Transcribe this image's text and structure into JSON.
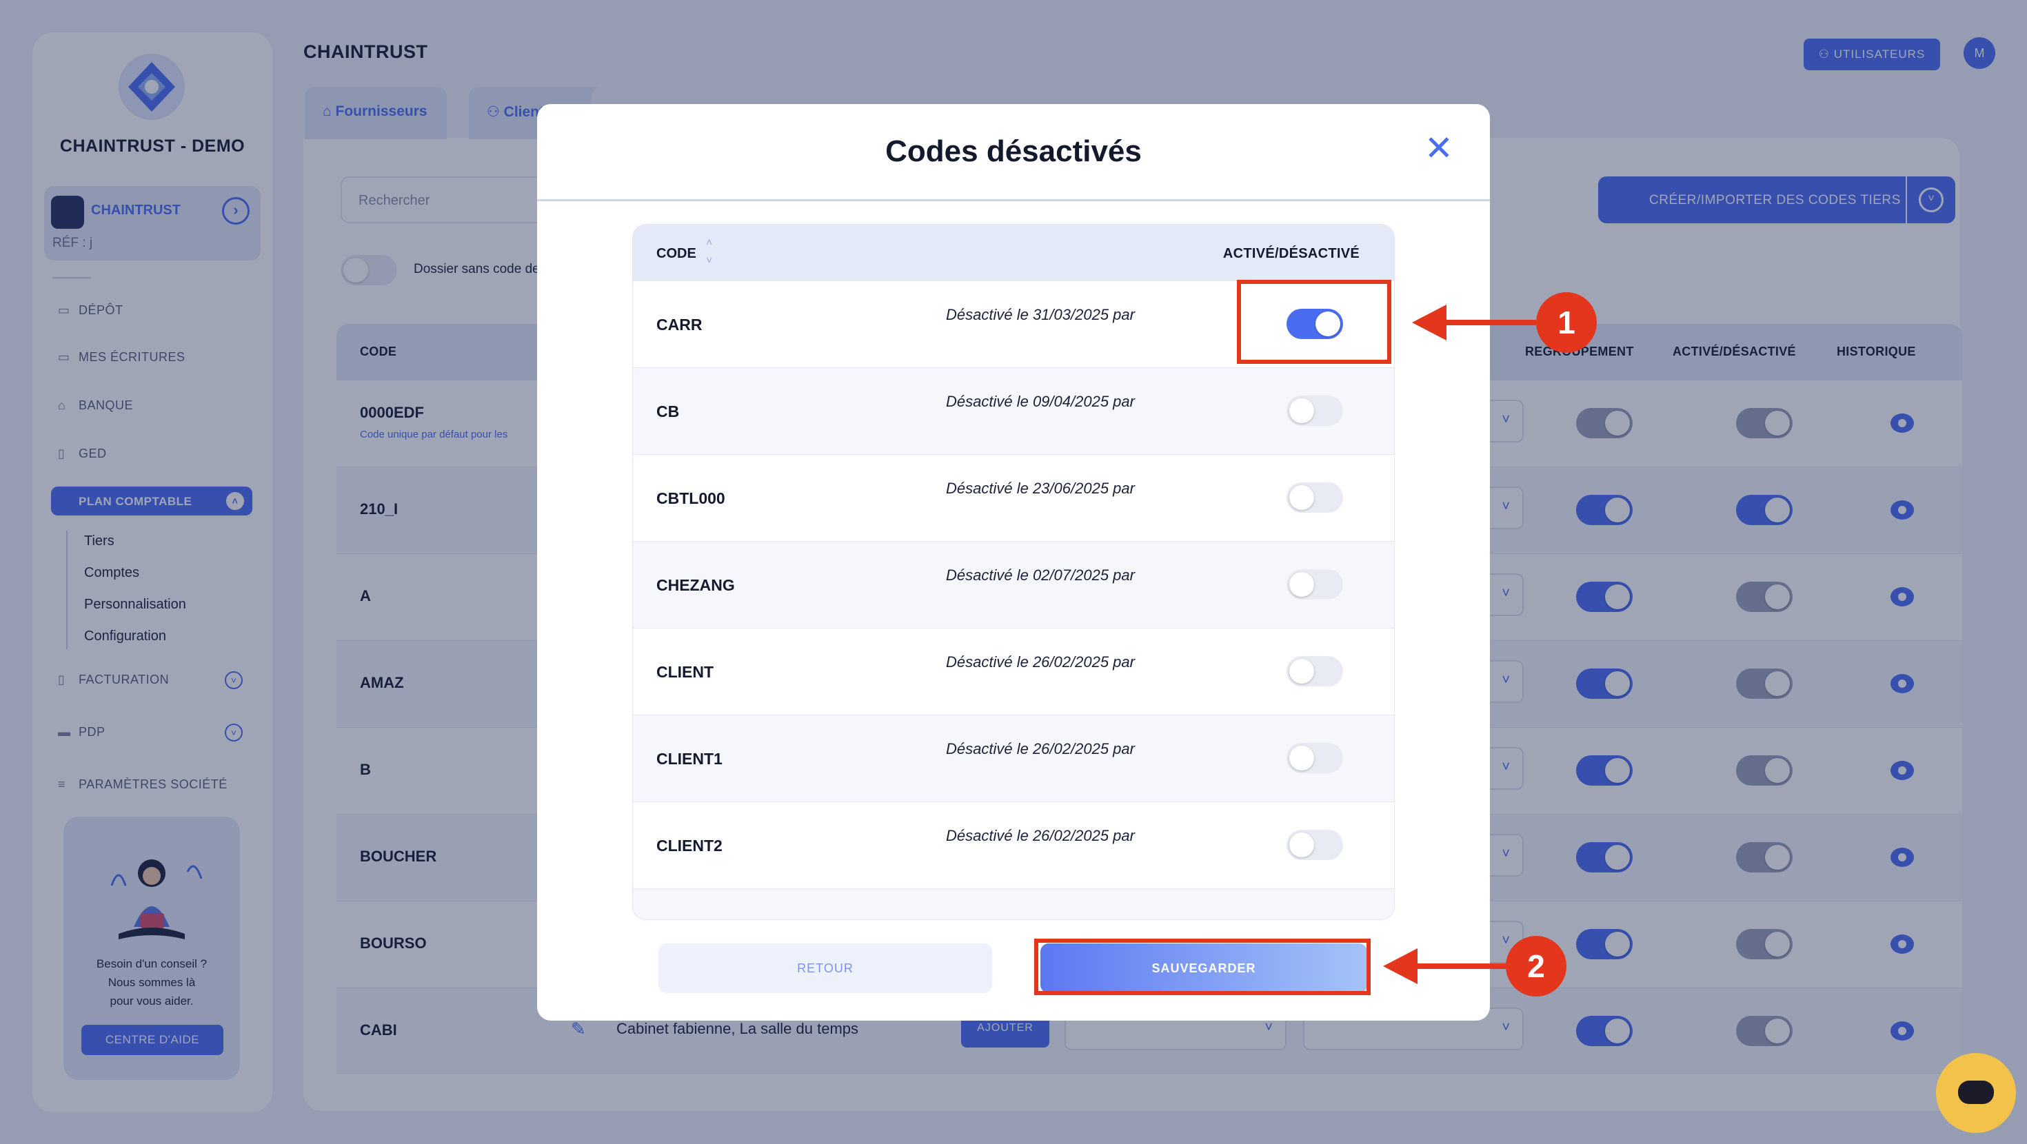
{
  "sidebar": {
    "company": "CHAINTRUST - DEMO",
    "card_name": "CHAINTRUST",
    "card_ref": "RÉF : j",
    "nav": [
      {
        "label": "DÉPÔT"
      },
      {
        "label": "MES ÉCRITURES"
      },
      {
        "label": "BANQUE"
      },
      {
        "label": "GED"
      }
    ],
    "plan_comptable": "PLAN COMPTABLE",
    "sub": [
      {
        "label": "Tiers"
      },
      {
        "label": "Comptes"
      },
      {
        "label": "Personnalisation"
      },
      {
        "label": "Configuration"
      }
    ],
    "facturation": "FACTURATION",
    "pdp": "PDP",
    "parametres": "PARAMÈTRES SOCIÉTÉ",
    "help_text_1": "Besoin d'un conseil ?",
    "help_text_2": "Nous sommes là",
    "help_text_3": "pour vous aider.",
    "help_button": "CENTRE D'AIDE"
  },
  "header": {
    "title": "CHAINTRUST",
    "users_button": "UTILISATEURS",
    "avatar": "M",
    "tabs": [
      {
        "label": "Fournisseurs"
      },
      {
        "label": "Clients"
      }
    ]
  },
  "main": {
    "search_placeholder": "Rechercher",
    "dossier_label": "Dossier sans code de",
    "create_button": "CRÉER/IMPORTER DES CODES TIERS",
    "columns": {
      "code": "CODE",
      "regroupement": "REGROUPEMENT",
      "active": "ACTIVÉ/DÉSACTIVÉ",
      "historique": "HISTORIQUE"
    },
    "default_code_note": "Code unique par défaut pour les",
    "rows": [
      {
        "code": "0000EDF"
      },
      {
        "code": "210_I"
      },
      {
        "code": "A"
      },
      {
        "code": "AMAZ"
      },
      {
        "code": "B"
      },
      {
        "code": "BOUCHER"
      },
      {
        "code": "BOURSO"
      },
      {
        "code": "CABI"
      }
    ],
    "cabi_name": "Cabinet fabienne, La salle du temps",
    "cabi_button": "AJOUTER"
  },
  "modal": {
    "title": "Codes désactivés",
    "col_code": "CODE",
    "col_active": "ACTIVÉ/DÉSACTIVÉ",
    "rows": [
      {
        "code": "CARR",
        "desc": "Désactivé le 31/03/2025 par",
        "active": true
      },
      {
        "code": "CB",
        "desc": "Désactivé le 09/04/2025 par",
        "active": false
      },
      {
        "code": "CBTL000",
        "desc": "Désactivé le 23/06/2025 par",
        "active": false
      },
      {
        "code": "CHEZANG",
        "desc": "Désactivé le 02/07/2025 par",
        "active": false
      },
      {
        "code": "CLIENT",
        "desc": "Désactivé le 26/02/2025 par",
        "active": false
      },
      {
        "code": "CLIENT1",
        "desc": "Désactivé le 26/02/2025 par",
        "active": false
      },
      {
        "code": "CLIENT2",
        "desc": "Désactivé le 26/02/2025 par",
        "active": false
      }
    ],
    "retour": "RETOUR",
    "sauvegarder": "SAUVEGARDER"
  },
  "annotations": {
    "badge1": "1",
    "badge2": "2"
  },
  "colors": {
    "accent": "#4a6cf0",
    "annotation_red": "#e3361d"
  }
}
